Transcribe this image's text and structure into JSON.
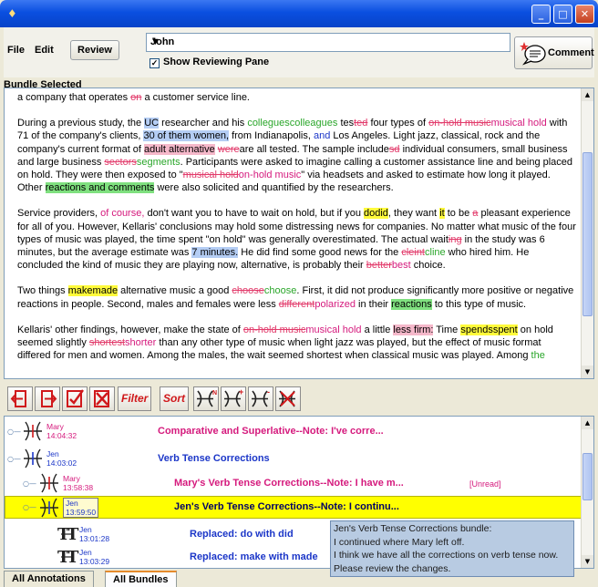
{
  "window": {
    "title": ""
  },
  "menu": {
    "file": "File",
    "edit": "Edit",
    "review": "Review"
  },
  "reviewer": {
    "name": "John"
  },
  "show_pane": {
    "label": "Show Reviewing Pane",
    "checked": true
  },
  "comment_button": {
    "label": "Comment"
  },
  "bundle_label": "Bundle Selected",
  "doc": {
    "p0": [
      [
        "a company that operates ",
        ""
      ],
      [
        "on",
        "del"
      ],
      [
        " a customer service line.",
        ""
      ]
    ],
    "p1": [
      [
        "During a previous study, the ",
        ""
      ],
      [
        "UC",
        "hl-b"
      ],
      [
        " researcher and his ",
        ""
      ],
      [
        "colleguescolleagues",
        "ins"
      ],
      [
        " tes",
        ""
      ],
      [
        "ted",
        "del"
      ],
      [
        " four types of ",
        ""
      ],
      [
        "on-hold music",
        "del"
      ],
      [
        "musical hold",
        "mag"
      ],
      [
        " with 71 of the company's clients, ",
        ""
      ],
      [
        "30 of them women,",
        "hl-b"
      ],
      [
        " from Indianapolis, ",
        ""
      ],
      [
        "and",
        "blue"
      ],
      [
        " Los Angeles. Light jazz, classical, rock and the company's current format of ",
        ""
      ],
      [
        "adult alternative",
        "hl-p"
      ],
      [
        " ",
        ""
      ],
      [
        "were",
        "del"
      ],
      [
        "are all tested. The sample include",
        ""
      ],
      [
        "sd",
        "del"
      ],
      [
        " individual consumers, small business and large business ",
        ""
      ],
      [
        "sectors",
        "del"
      ],
      [
        "segments",
        "ins"
      ],
      [
        ". Participants were asked to imagine calling a customer assistance line and being placed on hold. They were then exposed to \"",
        ""
      ],
      [
        "musical hold",
        "del"
      ],
      [
        "on-hold music",
        "mag"
      ],
      [
        "\" via headsets and asked to estimate how long it played. Other ",
        ""
      ],
      [
        "reactions and comments",
        "hl-g"
      ],
      [
        " were also solicited and quantified by the researchers.",
        ""
      ]
    ],
    "p2": [
      [
        "Service providers, ",
        ""
      ],
      [
        "of course,",
        "mag"
      ],
      [
        " don't want you to have to wait on hold, but if you ",
        ""
      ],
      [
        "dodid",
        "hl-y"
      ],
      [
        ", they want ",
        ""
      ],
      [
        "it",
        "hl-y"
      ],
      [
        " to be ",
        ""
      ],
      [
        "a",
        "del"
      ],
      [
        " pleasant experience for all of you. However, Kellaris' conclusions may hold some distressing news for companies. No matter what music of the four types of music was played, the time spent \"on hold\" was generally overestimated. The actual wait",
        ""
      ],
      [
        "ing",
        "del"
      ],
      [
        " in the study was 6 minutes, but the average estimate was ",
        ""
      ],
      [
        "7 minutes.",
        "hl-b"
      ],
      [
        " He did find some good news for the ",
        ""
      ],
      [
        "cleint",
        "del"
      ],
      [
        "cline",
        "ins"
      ],
      [
        " who hired him. He concluded the kind of music they are playing now, alternative, is probably their ",
        ""
      ],
      [
        "better",
        "del"
      ],
      [
        "best",
        "mag"
      ],
      [
        " choice.",
        ""
      ]
    ],
    "p3": [
      [
        "Two things ",
        ""
      ],
      [
        "makemade",
        "hl-y"
      ],
      [
        " alternative music a good ",
        ""
      ],
      [
        "choose",
        "del"
      ],
      [
        "choose",
        "ins"
      ],
      [
        ". First, it did not produce significantly more positive or negative reactions in people. Second, males and females were less ",
        ""
      ],
      [
        "different",
        "del"
      ],
      [
        "polarized",
        "mag"
      ],
      [
        " in their ",
        ""
      ],
      [
        "reactions",
        "hl-g"
      ],
      [
        " to this type of music.",
        ""
      ]
    ],
    "p4": [
      [
        "Kellaris' other findings, however, make the state of ",
        ""
      ],
      [
        "on-hold music",
        "del"
      ],
      [
        "musical hold",
        "mag"
      ],
      [
        " a little ",
        ""
      ],
      [
        "less firm:",
        "hl-p"
      ],
      [
        " Time ",
        ""
      ],
      [
        "spendsspent",
        "hl-y"
      ],
      [
        " on hold seemed slightly ",
        ""
      ],
      [
        "shortest",
        "del"
      ],
      [
        "shorter",
        "mag"
      ],
      [
        " than any other type of music when light jazz was played, but the effect of music format differed for men and women. Among the males, the wait seemed shortest when classical music was played. Among ",
        ""
      ],
      [
        "the",
        "ins"
      ]
    ]
  },
  "tools": {
    "filter": "Filter",
    "sort": "Sort"
  },
  "tree": {
    "rows": [
      {
        "author": "Mary",
        "time": "14:04:32",
        "title": "Comparative and Superlative--Note: I've corre...",
        "color": "mag"
      },
      {
        "author": "Jen",
        "time": "14:03:02",
        "title": "Verb Tense Corrections",
        "color": "blue"
      },
      {
        "author": "Mary",
        "time": "13:58:38",
        "title": "Mary's Verb Tense Corrections--Note: I have m...",
        "color": "mag",
        "badge": "[Unread]"
      },
      {
        "author": "Jen",
        "time": "13:59:50",
        "title": "Jen's Verb Tense Corrections--Note: I continu...",
        "color": "blue"
      },
      {
        "author": "Jen",
        "time": "13:01:28",
        "title": "Replaced: do with did",
        "color": "blue"
      },
      {
        "author": "Jen",
        "time": "13:03:29",
        "title": "Replaced: make with made",
        "color": "blue"
      }
    ]
  },
  "tooltip": {
    "line1": "Jen's Verb Tense Corrections bundle:",
    "line2": "I continued where Mary left off.",
    "line3": "I think we have all the corrections on verb tense now.",
    "line4": "Please review the changes."
  },
  "tabs": {
    "all_annotations": "All Annotations",
    "all_bundles": "All Bundles"
  },
  "colors": {
    "insert": "#2aa62a",
    "delete": "#e23b6b",
    "magenta": "#d51a7d",
    "blue": "#1b36c8",
    "selected_row": "#ffff00"
  }
}
